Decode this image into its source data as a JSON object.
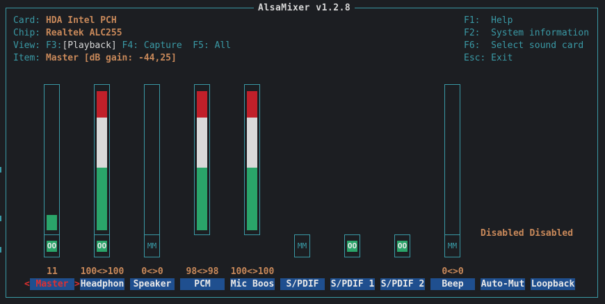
{
  "app": {
    "title": "AlsaMixer v1.2.8"
  },
  "info": {
    "card_label": "Card:",
    "card_value": "HDA Intel PCH",
    "chip_label": "Chip:",
    "chip_value": "Realtek ALC255",
    "view_label": "View:",
    "view_f3": "F3:",
    "view_playback": "[Playback]",
    "view_rest": " F4: Capture  F5: All",
    "item_label": "Item:",
    "item_value": "Master [dB gain: -44,25]"
  },
  "help": [
    {
      "key": "F1:",
      "text": "Help"
    },
    {
      "key": "F2:",
      "text": "System information"
    },
    {
      "key": "F6:",
      "text": "Select sound card"
    },
    {
      "key": "Esc:",
      "text": "Exit"
    }
  ],
  "controls": [
    {
      "name": "Master",
      "volume": "11",
      "level": 0.11,
      "mute": "OO",
      "selected": true
    },
    {
      "name": "Headphon",
      "volume": "100<>100",
      "level": 1.0,
      "mute": "OO"
    },
    {
      "name": "Speaker",
      "volume": "0<>0",
      "level": 0,
      "mute": "MM"
    },
    {
      "name": "PCM",
      "volume": "98<>98",
      "level": 1.0,
      "mute": ""
    },
    {
      "name": "Mic Boos",
      "volume": "100<>100",
      "level": 1.0,
      "mute": ""
    },
    {
      "name": "S/PDIF",
      "volume": "",
      "mute": "MM"
    },
    {
      "name": "S/PDIF 1",
      "volume": "",
      "mute": "OO"
    },
    {
      "name": "S/PDIF 2",
      "volume": "",
      "mute": "OO"
    },
    {
      "name": "Beep",
      "volume": "0<>0",
      "level": 0,
      "mute": "MM"
    },
    {
      "name": "Auto-Mut",
      "volume": ""
    },
    {
      "name": "Loopback",
      "volume": ""
    }
  ],
  "disabled_text": "Disabled Disabled",
  "selection_markers": {
    "left": "<",
    "right": ">"
  },
  "colors": {
    "border": "#3a9aa6",
    "value": "#c9895a",
    "label_bg": "#1f4f8f",
    "green": "#2aa56a",
    "red": "#c0202a",
    "white": "#d9d9d9"
  }
}
